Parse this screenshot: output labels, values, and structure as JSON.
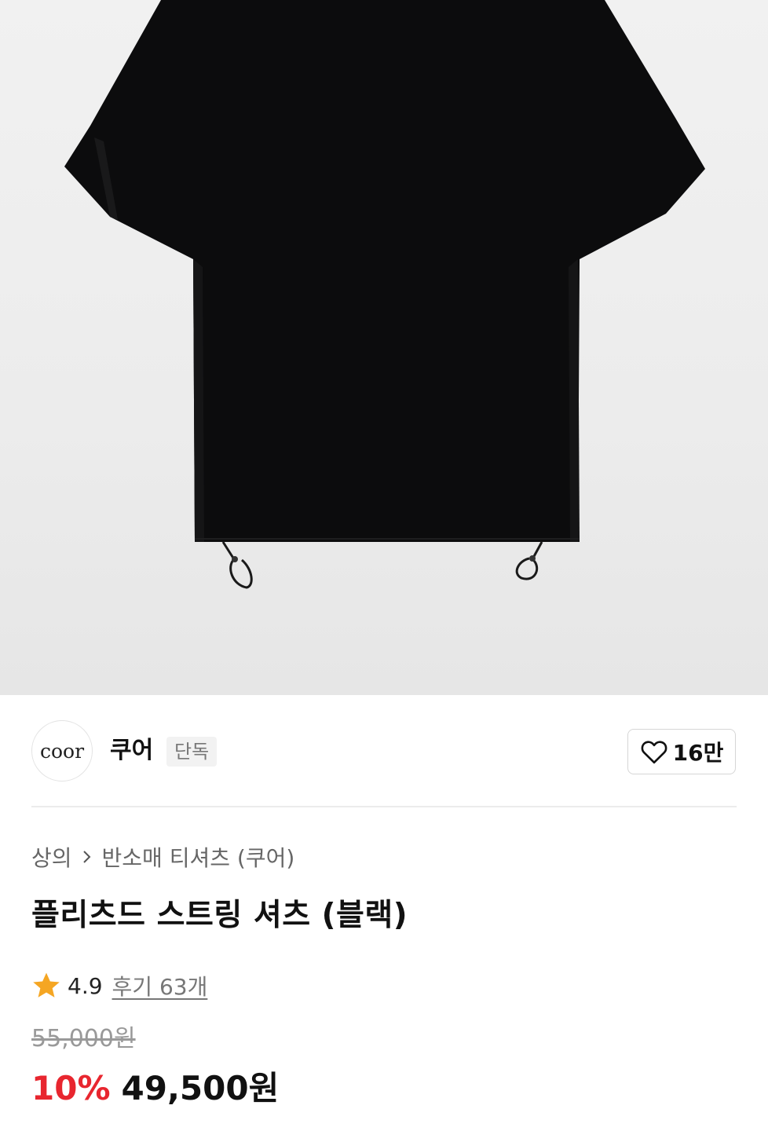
{
  "hero": {
    "image_alt": "black short sleeve shirt with drawstring hem",
    "background": "#ededed"
  },
  "brand": {
    "logo_text": "coor",
    "name": "쿠어",
    "tag": "단독",
    "likes": "16만",
    "heart_icon": "heart-outline-icon"
  },
  "breadcrumb": {
    "category": "상의",
    "separator_icon": "chevron-right-icon",
    "subcategory": "반소매 티셔츠 (쿠어)"
  },
  "product": {
    "title": "플리츠드 스트링 셔츠 (블랙)",
    "rating": "4.9",
    "star_icon": "star-icon",
    "star_color": "#f5a623",
    "reviews": "후기 63개",
    "original_price": "55,000원",
    "discount": "10%",
    "discount_color": "#e8262f",
    "sale_price": "49,500원"
  }
}
